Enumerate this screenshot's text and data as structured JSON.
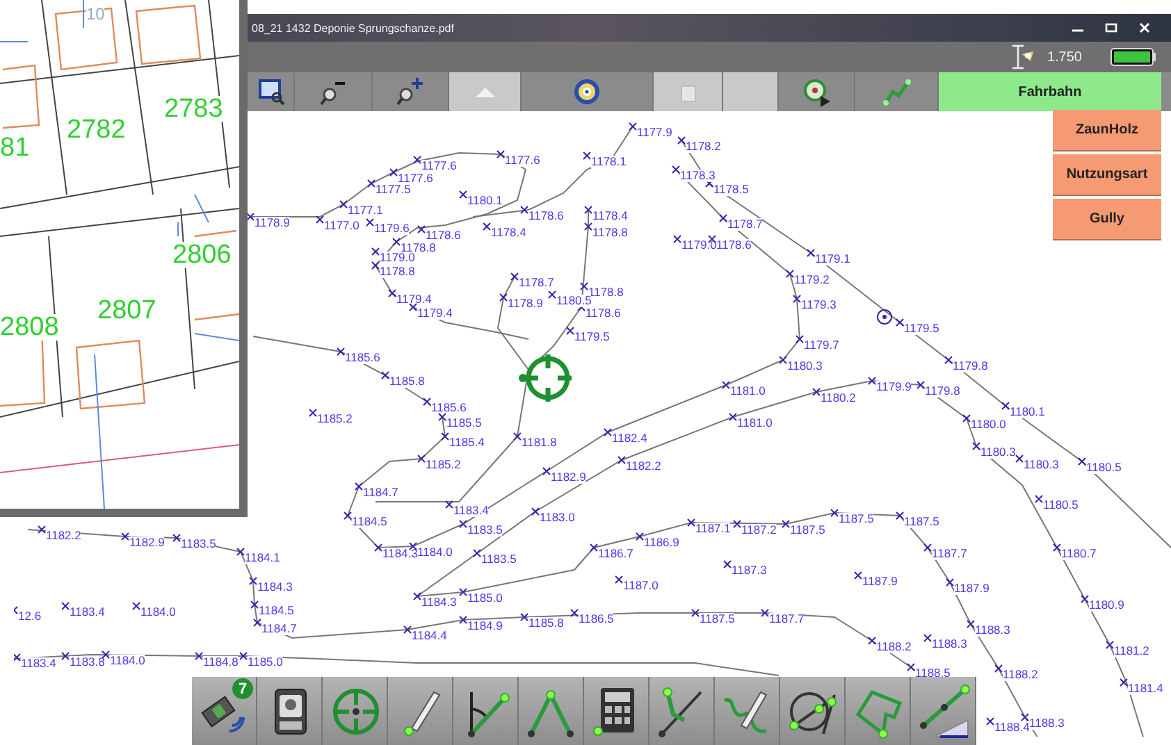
{
  "window": {
    "title": "08_21 1432 Deponie Sprungschanze.pdf"
  },
  "status_bar": {
    "scale": "1.750"
  },
  "toolbar": [
    {
      "kind": "zoom-window",
      "disabled": false
    },
    {
      "kind": "zoom-out",
      "disabled": false
    },
    {
      "kind": "zoom-in",
      "disabled": false
    },
    {
      "kind": "arrow-up",
      "disabled": true
    },
    {
      "kind": "center",
      "disabled": false
    },
    {
      "kind": "copy",
      "disabled": true
    },
    {
      "kind": "blank",
      "disabled": true
    },
    {
      "kind": "gps-play",
      "disabled": false
    },
    {
      "kind": "line",
      "disabled": false
    }
  ],
  "layers": [
    {
      "label": "Fahrbahn",
      "selected": true
    },
    {
      "label": "ZaunHolz",
      "selected": false
    },
    {
      "label": "Nutzungsart",
      "selected": false
    },
    {
      "label": "Gully",
      "selected": false
    }
  ],
  "inset_map": {
    "numbers": [
      {
        "label": "10",
        "kind": "house"
      },
      {
        "label": "2782",
        "kind": "parcel"
      },
      {
        "label": "2783",
        "kind": "parcel"
      },
      {
        "label": "81",
        "kind": "parcel"
      },
      {
        "label": "2806",
        "kind": "parcel"
      },
      {
        "label": "2807",
        "kind": "parcel"
      },
      {
        "label": "2808",
        "kind": "parcel"
      }
    ]
  },
  "survey_points": [
    {
      "label": "1177.9"
    },
    {
      "label": "1178.2"
    },
    {
      "label": "1178.1"
    },
    {
      "label": "1178.5"
    },
    {
      "label": "1178.3"
    },
    {
      "label": "1178.9"
    },
    {
      "label": "1177.0"
    },
    {
      "label": "1177.1"
    },
    {
      "label": "1177.5"
    },
    {
      "label": "1177.6"
    },
    {
      "label": "1177.6"
    },
    {
      "label": "1177.6"
    },
    {
      "label": "1180.1"
    },
    {
      "label": "1179.6"
    },
    {
      "label": "1178.6"
    },
    {
      "label": "1178.4"
    },
    {
      "label": "1178.8"
    },
    {
      "label": "1179.0"
    },
    {
      "label": "1178.8"
    },
    {
      "label": "1179.4"
    },
    {
      "label": "1179.4"
    },
    {
      "label": "1178.6"
    },
    {
      "label": "1178.4"
    },
    {
      "label": "1178.8"
    },
    {
      "label": "1178.7"
    },
    {
      "label": "1178.9"
    },
    {
      "label": "1178.8"
    },
    {
      "label": "1178.6"
    },
    {
      "label": "1180.5"
    },
    {
      "label": "1179.5"
    },
    {
      "label": "1179.1"
    },
    {
      "label": "1179.2"
    },
    {
      "label": "1179.3"
    },
    {
      "label": "1179.5"
    },
    {
      "label": "1179.7"
    },
    {
      "label": "1180.3"
    },
    {
      "label": "1179.8"
    },
    {
      "label": "1181.0"
    },
    {
      "label": "1180.2"
    },
    {
      "label": "1179.9"
    },
    {
      "label": "1179.8"
    },
    {
      "label": "1180.1"
    },
    {
      "label": "1181.0"
    },
    {
      "label": "1180.0"
    },
    {
      "label": "1180.3"
    },
    {
      "label": "1180.3"
    },
    {
      "label": "1180.5"
    },
    {
      "label": "1178.7"
    },
    {
      "label": "1179.0"
    },
    {
      "label": "1178.6"
    },
    {
      "label": "1185.6"
    },
    {
      "label": "1185.8"
    },
    {
      "label": "1185.2"
    },
    {
      "label": "1185.6"
    },
    {
      "label": "1185.5"
    },
    {
      "label": "1185.4"
    },
    {
      "label": "1181.8"
    },
    {
      "label": "1182.4"
    },
    {
      "label": "1185.2"
    },
    {
      "label": "1182.9"
    },
    {
      "label": "1182.2"
    },
    {
      "label": "1184.7"
    },
    {
      "label": "1183.4"
    },
    {
      "label": "1184.5"
    },
    {
      "label": "1183.5"
    },
    {
      "label": "1183.0"
    },
    {
      "label": "1184.3"
    },
    {
      "label": "1184.0"
    },
    {
      "label": "1183.5"
    },
    {
      "label": "1182.2"
    },
    {
      "label": "1182.9"
    },
    {
      "label": "1183.5"
    },
    {
      "label": "1184.1"
    },
    {
      "label": "1184.3"
    },
    {
      "label": "1183.4"
    },
    {
      "label": "1184.0"
    },
    {
      "label": "1184.5"
    },
    {
      "label": "1184.7"
    },
    {
      "label": "1184.4"
    },
    {
      "label": "1184.9"
    },
    {
      "label": "1185.8"
    },
    {
      "label": "1183.4"
    },
    {
      "label": "1183.8"
    },
    {
      "label": "1184.0"
    },
    {
      "label": "1184.8"
    },
    {
      "label": "1185.0"
    },
    {
      "label": "1184.3"
    },
    {
      "label": "1185.0"
    },
    {
      "label": "12.6"
    },
    {
      "label": "1187.1"
    },
    {
      "label": "1187.2"
    },
    {
      "label": "1187.5"
    },
    {
      "label": "1187.5"
    },
    {
      "label": "1187.5"
    },
    {
      "label": "1186.9"
    },
    {
      "label": "1186.7"
    },
    {
      "label": "1187.3"
    },
    {
      "label": "1187.0"
    },
    {
      "label": "1187.9"
    },
    {
      "label": "1187.7"
    },
    {
      "label": "1187.9"
    },
    {
      "label": "1186.5"
    },
    {
      "label": "1187.5"
    },
    {
      "label": "1187.7"
    },
    {
      "label": "1188.2"
    },
    {
      "label": "1188.3"
    },
    {
      "label": "1188.5"
    },
    {
      "label": "1188.3"
    },
    {
      "label": "1188.2"
    },
    {
      "label": "1180.7"
    },
    {
      "label": "1180.9"
    },
    {
      "label": "1181.2"
    },
    {
      "label": "1181.4"
    },
    {
      "label": "1188.4"
    },
    {
      "label": "1188.3"
    },
    {
      "label": "1180.5"
    }
  ],
  "bottom_tools": [
    {
      "kind": "gnss",
      "badge": "7"
    },
    {
      "kind": "total-station"
    },
    {
      "kind": "target"
    },
    {
      "kind": "pen-point"
    },
    {
      "kind": "angle"
    },
    {
      "kind": "polyline"
    },
    {
      "kind": "calculator"
    },
    {
      "kind": "snap-line"
    },
    {
      "kind": "sketch"
    },
    {
      "kind": "construct"
    },
    {
      "kind": "building"
    },
    {
      "kind": "slope"
    }
  ]
}
